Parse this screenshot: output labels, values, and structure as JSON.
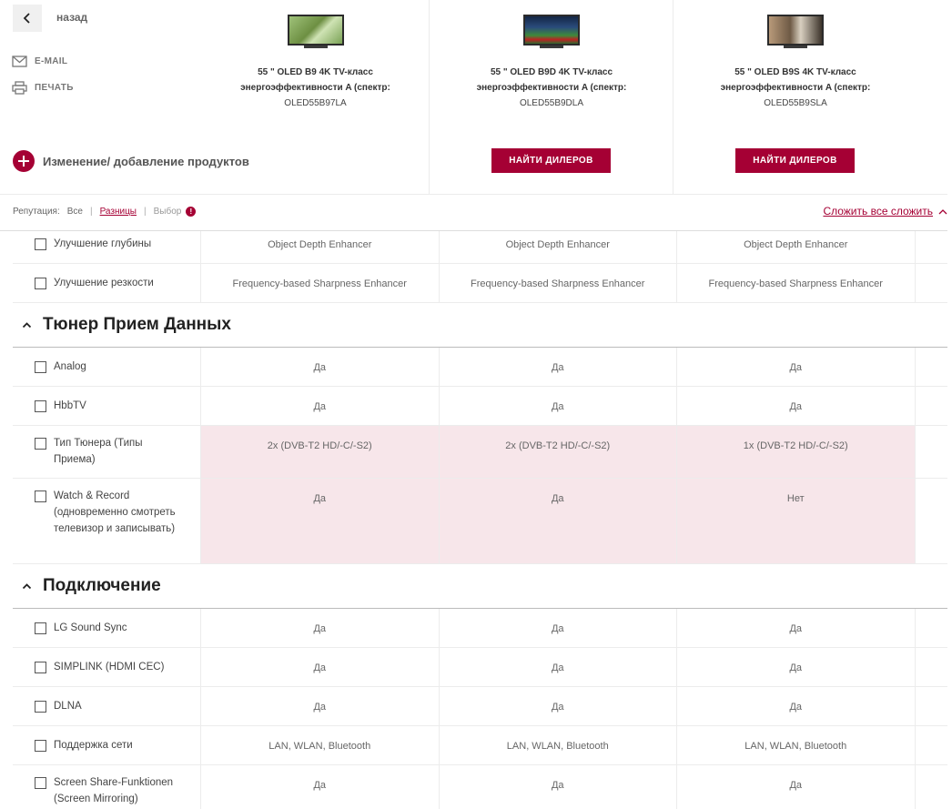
{
  "nav": {
    "back_label": "назад",
    "email_label": "E-MAIL",
    "print_label": "ПЕЧАТЬ"
  },
  "add_products_label": "Изменение/ добавление продуктов",
  "products": [
    {
      "name": "55 \" OLED B9 4K TV-класс энергоэффективности A (спектр:",
      "model": "OLED55B97LA",
      "button": ""
    },
    {
      "name": "55 \" OLED B9D 4K TV-класс энергоэффективности A (спектр:",
      "model": "OLED55B9DLA",
      "button": "НАЙТИ ДИЛЕРОВ"
    },
    {
      "name": "55 \" OLED B9S 4K TV-класс энергоэффективности A (спектр:",
      "model": "OLED55B9SLA",
      "button": "НАЙТИ ДИЛЕРОВ"
    }
  ],
  "filter": {
    "label": "Репутация:",
    "all": "Все",
    "differences": "Разницы",
    "selection": "Выбор",
    "warn": "!",
    "collapse_all": "Сложить все сложить"
  },
  "rows_top": [
    {
      "label": "Улучшение глубины",
      "values": [
        "Object Depth Enhancer",
        "Object Depth Enhancer",
        "Object Depth Enhancer"
      ]
    },
    {
      "label": "Улучшение резкости",
      "values": [
        "Frequency-based Sharpness Enhancer",
        "Frequency-based Sharpness Enhancer",
        "Frequency-based Sharpness Enhancer"
      ]
    }
  ],
  "sections": [
    {
      "title": "Тюнер Прием Данных",
      "rows": [
        {
          "label": "Analog",
          "values": [
            "Да",
            "Да",
            "Да"
          ]
        },
        {
          "label": "HbbTV",
          "values": [
            "Да",
            "Да",
            "Да"
          ]
        },
        {
          "label": "Тип Тюнера (Типы Приема)",
          "values": [
            "2x (DVB-T2 HD/-C/-S2)",
            "2x (DVB-T2 HD/-C/-S2)",
            "1x (DVB-T2 HD/-C/-S2)"
          ]
        },
        {
          "label": "Watch & Record (одновременно смотреть телевизор и записывать)",
          "values": [
            "Да",
            "Да",
            "Нет"
          ]
        }
      ]
    },
    {
      "title": "Подключение",
      "rows": [
        {
          "label": "LG Sound Sync",
          "values": [
            "Да",
            "Да",
            "Да"
          ]
        },
        {
          "label": "SIMPLINK (HDMI CEC)",
          "values": [
            "Да",
            "Да",
            "Да"
          ]
        },
        {
          "label": "DLNA",
          "values": [
            "Да",
            "Да",
            "Да"
          ]
        },
        {
          "label": "Поддержка сети",
          "values": [
            "LAN, WLAN, Bluetooth",
            "LAN, WLAN, Bluetooth",
            "LAN, WLAN, Bluetooth"
          ]
        },
        {
          "label": "Screen Share-Funktionen (Screen Mirroring)",
          "values": [
            "Да",
            "Да",
            "Да"
          ]
        }
      ]
    }
  ],
  "colors": {
    "accent": "#a50034",
    "diff_highlight": "#f7e6ea"
  },
  "icons": [
    "chevron-left-icon",
    "envelope-icon",
    "printer-icon",
    "plus-icon",
    "chevron-up-icon",
    "warning-icon"
  ]
}
